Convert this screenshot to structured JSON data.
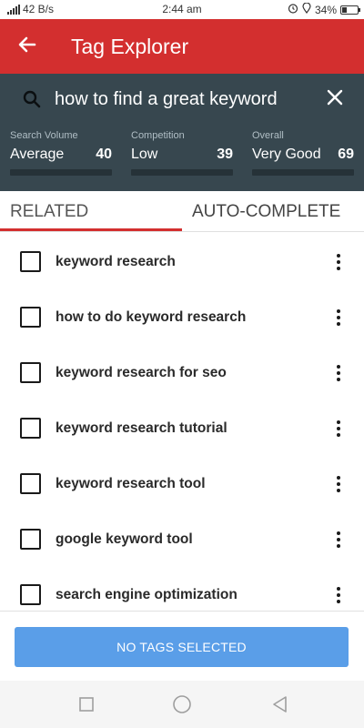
{
  "status_bar": {
    "net_speed": "42 B/s",
    "time": "2:44 am",
    "battery": "34%",
    "battery_level": 0.34
  },
  "app_bar": {
    "title": "Tag Explorer",
    "back_icon": "arrow-back-icon"
  },
  "search": {
    "query": "how to find a great keyword",
    "icon": "search-icon",
    "clear_icon": "close-icon"
  },
  "metrics": [
    {
      "label": "Search Volume",
      "value": "Average",
      "score": "40"
    },
    {
      "label": "Competition",
      "value": "Low",
      "score": "39"
    },
    {
      "label": "Overall",
      "value": "Very Good",
      "score": "69"
    }
  ],
  "tabs": [
    {
      "label": "RELATED",
      "active": true
    },
    {
      "label": "AUTO-COMPLETE",
      "active": false
    }
  ],
  "items": [
    {
      "label": "keyword research",
      "checked": false
    },
    {
      "label": "how to do keyword research",
      "checked": false
    },
    {
      "label": "keyword research for seo",
      "checked": false
    },
    {
      "label": "keyword research tutorial",
      "checked": false
    },
    {
      "label": "keyword research tool",
      "checked": false
    },
    {
      "label": "google keyword tool",
      "checked": false
    },
    {
      "label": "search engine optimization",
      "checked": false
    }
  ],
  "action_button": {
    "label": "NO TAGS SELECTED",
    "color": "#5a9ee8"
  },
  "colors": {
    "primary": "#d32f2f",
    "panel": "#37474f"
  },
  "nav_bar": {
    "icons": [
      "recents-square-icon",
      "home-circle-icon",
      "back-triangle-icon"
    ]
  }
}
